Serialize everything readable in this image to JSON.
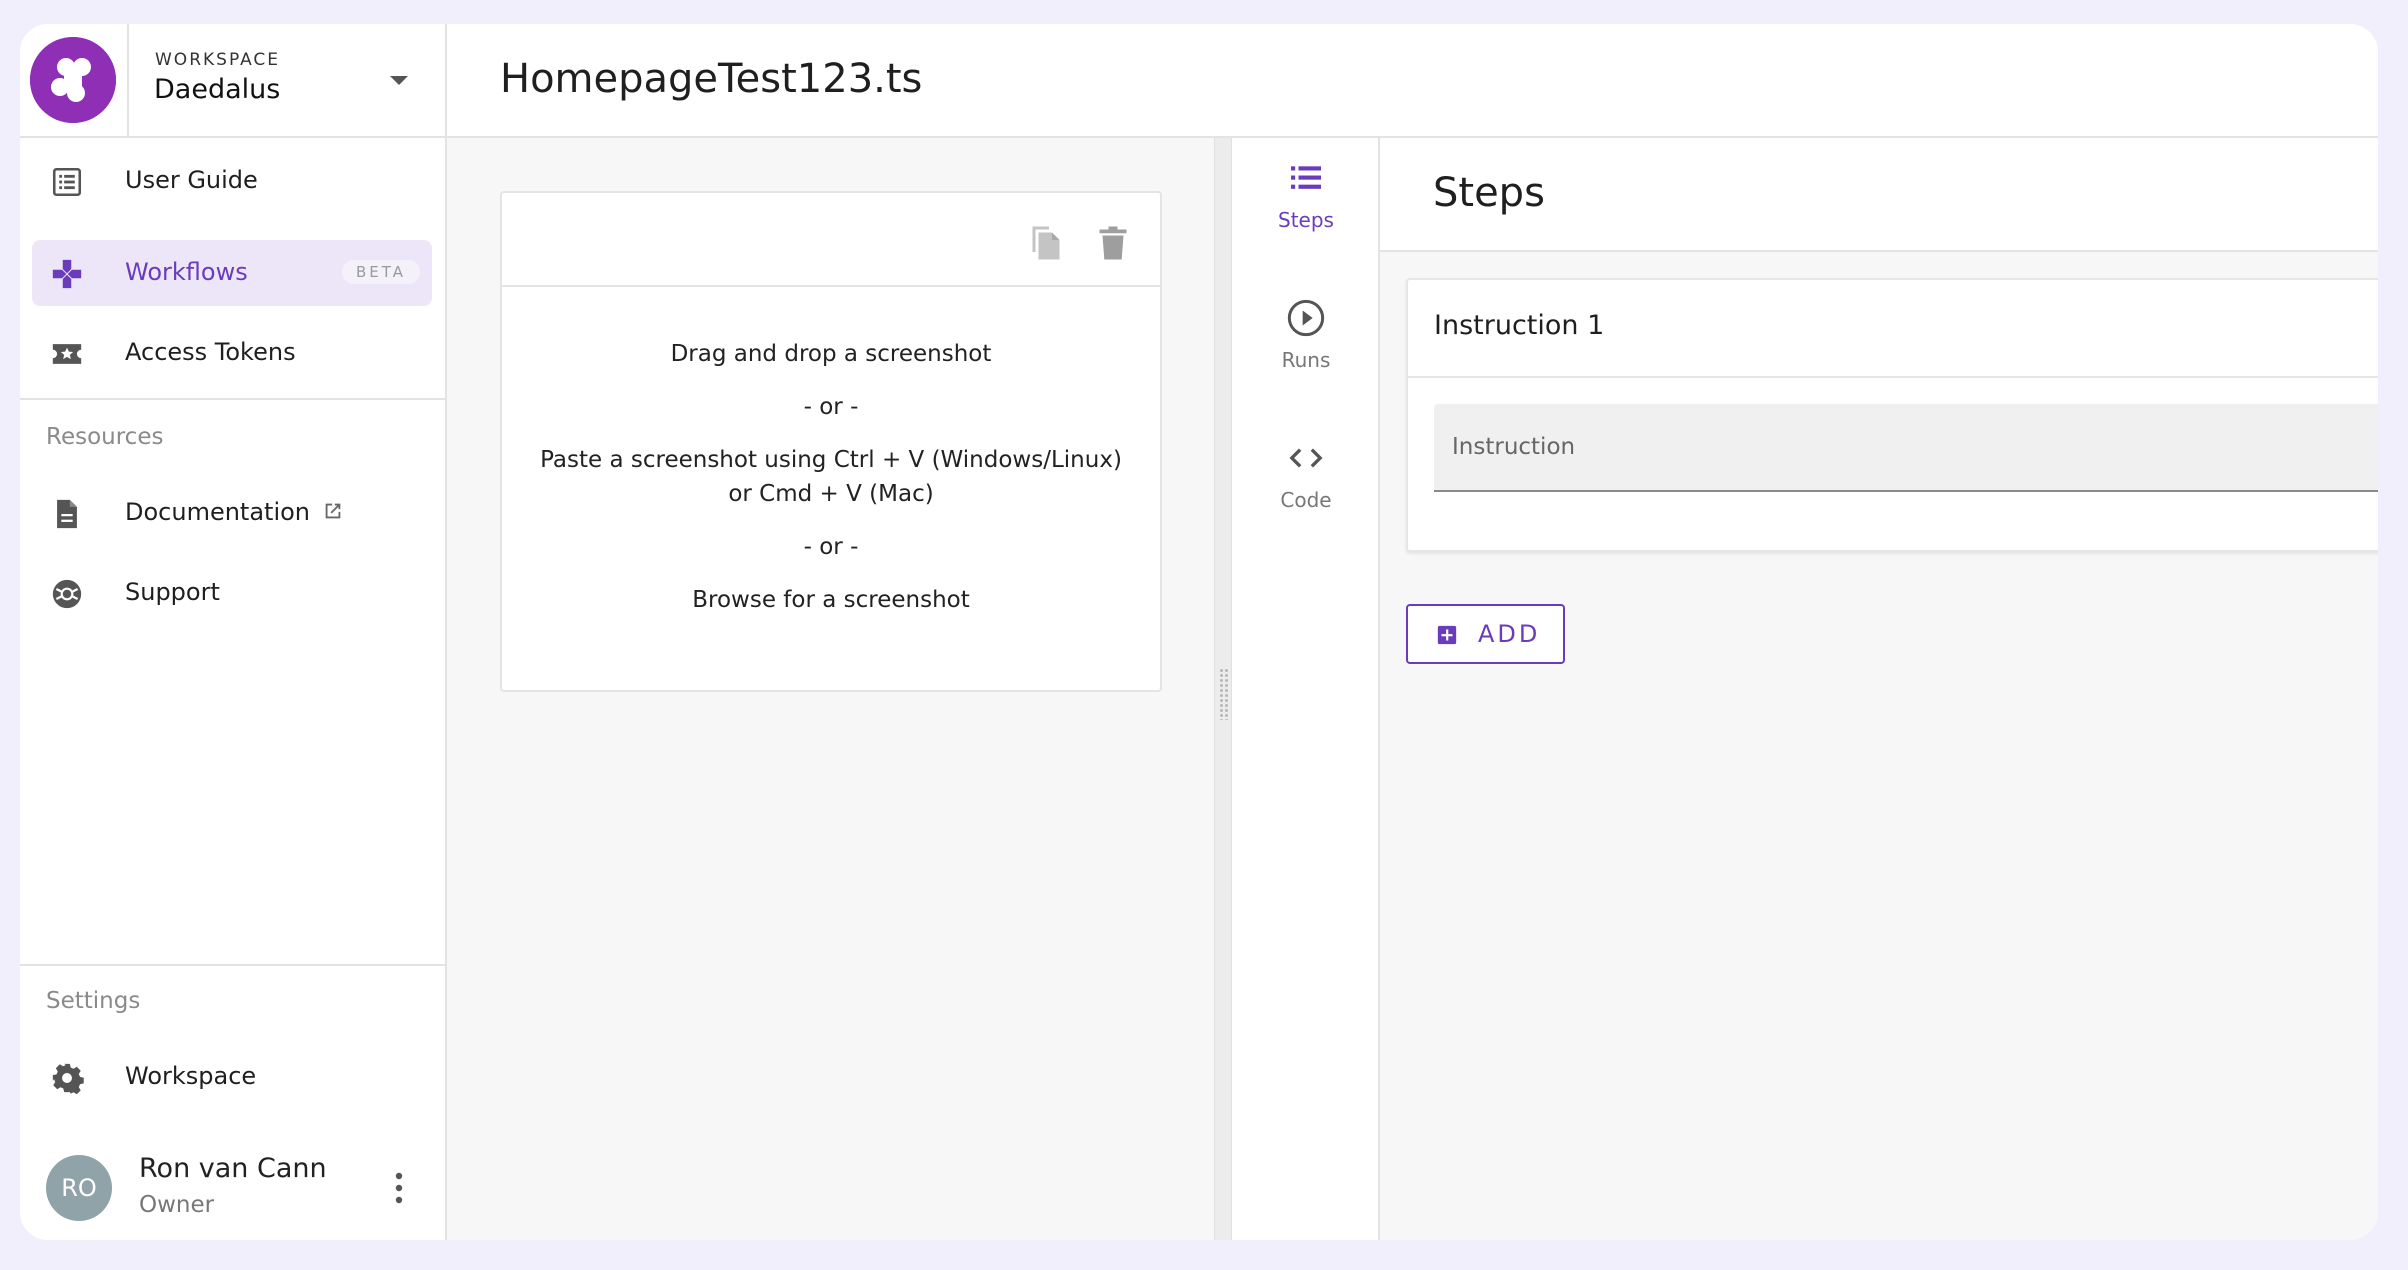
{
  "workspace": {
    "label": "WORKSPACE",
    "name": "Daedalus"
  },
  "nav": {
    "user_guide": "User Guide",
    "workflows": "Workflows",
    "workflows_badge": "BETA",
    "access_tokens": "Access Tokens"
  },
  "resources": {
    "title": "Resources",
    "documentation": "Documentation",
    "support": "Support"
  },
  "settings": {
    "title": "Settings",
    "workspace": "Workspace"
  },
  "user": {
    "initials": "RO",
    "name": "Ron van Cann",
    "role": "Owner"
  },
  "page_title": "HomepageTest123.ts",
  "dropzone": {
    "line1": "Drag and drop a screenshot",
    "or1": "- or -",
    "line2a": "Paste a screenshot using Ctrl + V (Windows/Linux)",
    "line2b": "or Cmd + V (Mac)",
    "or2": "- or -",
    "line3": "Browse for a screenshot"
  },
  "rail": {
    "steps": "Steps",
    "runs": "Runs",
    "code": "Code"
  },
  "steps": {
    "title": "Steps",
    "instruction_title": "Instruction 1",
    "instruction_placeholder": "Instruction",
    "add_label": "ADD"
  },
  "colors": {
    "accent": "#6a3cbc",
    "brand": "#8e2fb6",
    "avatar": "#8fa3a8"
  },
  "icons": [
    "logo-icon",
    "list-icon",
    "gamepad-icon",
    "ticket-star-icon",
    "document-icon",
    "external-link-icon",
    "lifebuoy-icon",
    "gear-icon",
    "more-vert-icon",
    "copy-icon",
    "trash-icon",
    "steps-list-icon",
    "play-circle-icon",
    "code-icon",
    "add-box-icon"
  ]
}
